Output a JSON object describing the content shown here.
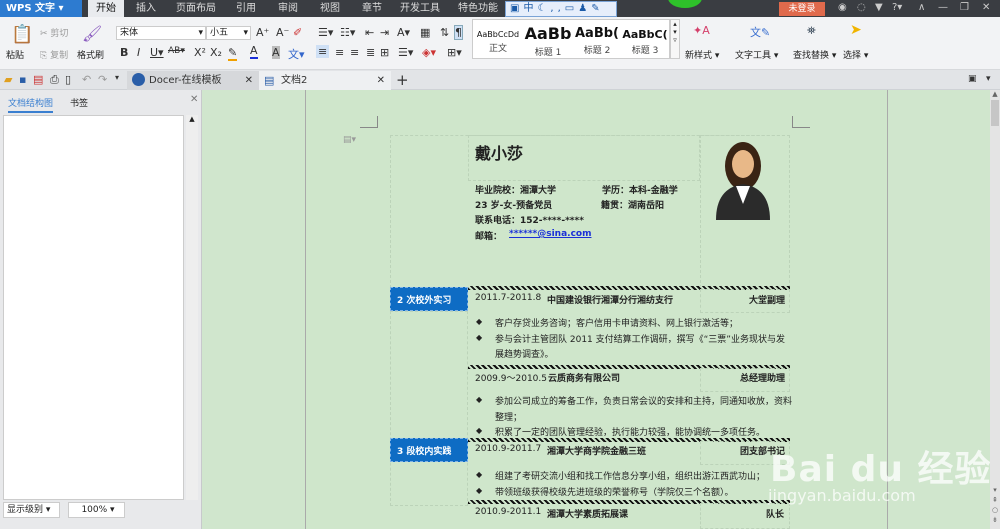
{
  "app": {
    "name": "WPS 文字",
    "menu_tabs": [
      "开始",
      "插入",
      "页面布局",
      "引用",
      "审阅",
      "视图",
      "章节",
      "开发工具",
      "特色功能"
    ],
    "active_tab": "开始",
    "ime_label": "中",
    "login_label": "未登录"
  },
  "ribbon": {
    "paste": "粘贴",
    "cut": "剪切",
    "copy": "复制",
    "format_painter": "格式刷",
    "font": "宋体",
    "size": "小五",
    "styles": [
      {
        "sample": "AaBbCcDd",
        "label": "正文"
      },
      {
        "sample": "AaBb",
        "label": "标题 1"
      },
      {
        "sample": "AaBb(",
        "label": "标题 2"
      },
      {
        "sample": "AaBbC(",
        "label": "标题 3"
      }
    ],
    "new_style": "新样式",
    "text_tools": "文字工具",
    "find_replace": "查找替换",
    "select": "选择"
  },
  "tabs": [
    {
      "label": "Docer-在线模板"
    },
    {
      "label": "文档2"
    }
  ],
  "left_panel": {
    "tabs": [
      "文档结构图",
      "书签"
    ],
    "level_select": "显示级别",
    "zoom": "100%"
  },
  "resume": {
    "name": "戴小莎",
    "school": "毕业院校：湘潭大学",
    "degree": "学历：本科-金融学",
    "age": "23 岁-女-预备党员",
    "origin": "籍贯：湖南岳阳",
    "phone": "联系电话：152-****-****",
    "email_label": "邮箱：",
    "email": "******@sina.com",
    "sections": [
      {
        "title": "2 次校外实习"
      },
      {
        "title": "3 段校内实践"
      }
    ],
    "entries": [
      {
        "date": "2011.7-2011.8",
        "org": "中国建设银行湘潭分行湘纺支行",
        "role": "大堂副理",
        "bullets": [
          "客户存贷业务咨询；客户信用卡申请资料、网上银行激活等；",
          "参与会计主管团队 2011 支付结算工作调研，撰写《“三票”业务现状与发",
          "展趋势调查》。"
        ]
      },
      {
        "date": "2009.9～2010.5",
        "org": "云质商务有限公司",
        "role": "总经理助理",
        "bullets": [
          "参加公司成立的筹备工作，负责日常会议的安排和主持，同通知收放，资料",
          "整理；",
          "积累了一定的团队管理经验，执行能力较强，能协调统一多项任务。"
        ]
      },
      {
        "date": "2010.9-2011.7",
        "org": "湘潭大学商学院金融三班",
        "role": "团支部书记",
        "bullets": [
          "组建了考研交流小组和找工作信息分享小组，组织出游江西武功山；",
          "带领班级获得校级先进班级的荣誉称号（学院仅三个名额）。"
        ]
      },
      {
        "date": "2010.9-2011.1",
        "org": "湘潭大学素质拓展课",
        "role": "队长"
      }
    ]
  },
  "watermark": {
    "logo": "Bai du 经验",
    "url": "jingyan.baidu.com"
  }
}
